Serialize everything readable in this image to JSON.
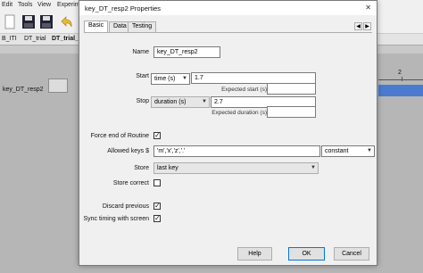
{
  "background": {
    "menu": [
      "Edit",
      "Tools",
      "View",
      "Experim"
    ],
    "tabs": [
      "B_ITI",
      "DT_trial",
      "DT_trial_re"
    ],
    "component_label": "key_DT_resp2",
    "timeline_number": "2",
    "bar_color": "#4a7bd1"
  },
  "dialog": {
    "title": "key_DT_resp2 Properties",
    "close": "✕",
    "tabs": [
      "Basic",
      "Data",
      "Testing"
    ],
    "active_tab": "Basic",
    "fields": {
      "name_label": "Name",
      "name_value": "key_DT_resp2",
      "start_label": "Start",
      "start_type": "time (s)",
      "start_value": "1.7",
      "expected_start_label": "Expected start (s)",
      "stop_label": "Stop",
      "stop_type": "duration (s)",
      "stop_value": "2.7",
      "expected_duration_label": "Expected duration (s)",
      "force_end_label": "Force end of Routine",
      "force_end_checked": true,
      "allowed_keys_label": "Allowed keys $",
      "allowed_keys_value": "'m','x','z','.'",
      "allowed_keys_mode": "constant",
      "store_label": "Store",
      "store_value": "last key",
      "store_correct_label": "Store correct",
      "store_correct_checked": false,
      "discard_previous_label": "Discard previous",
      "discard_previous_checked": true,
      "sync_timing_label": "Sync timing with screen",
      "sync_timing_checked": true
    },
    "buttons": {
      "help": "Help",
      "ok": "OK",
      "cancel": "Cancel"
    }
  },
  "colors": {
    "accent": "#0078d7"
  }
}
